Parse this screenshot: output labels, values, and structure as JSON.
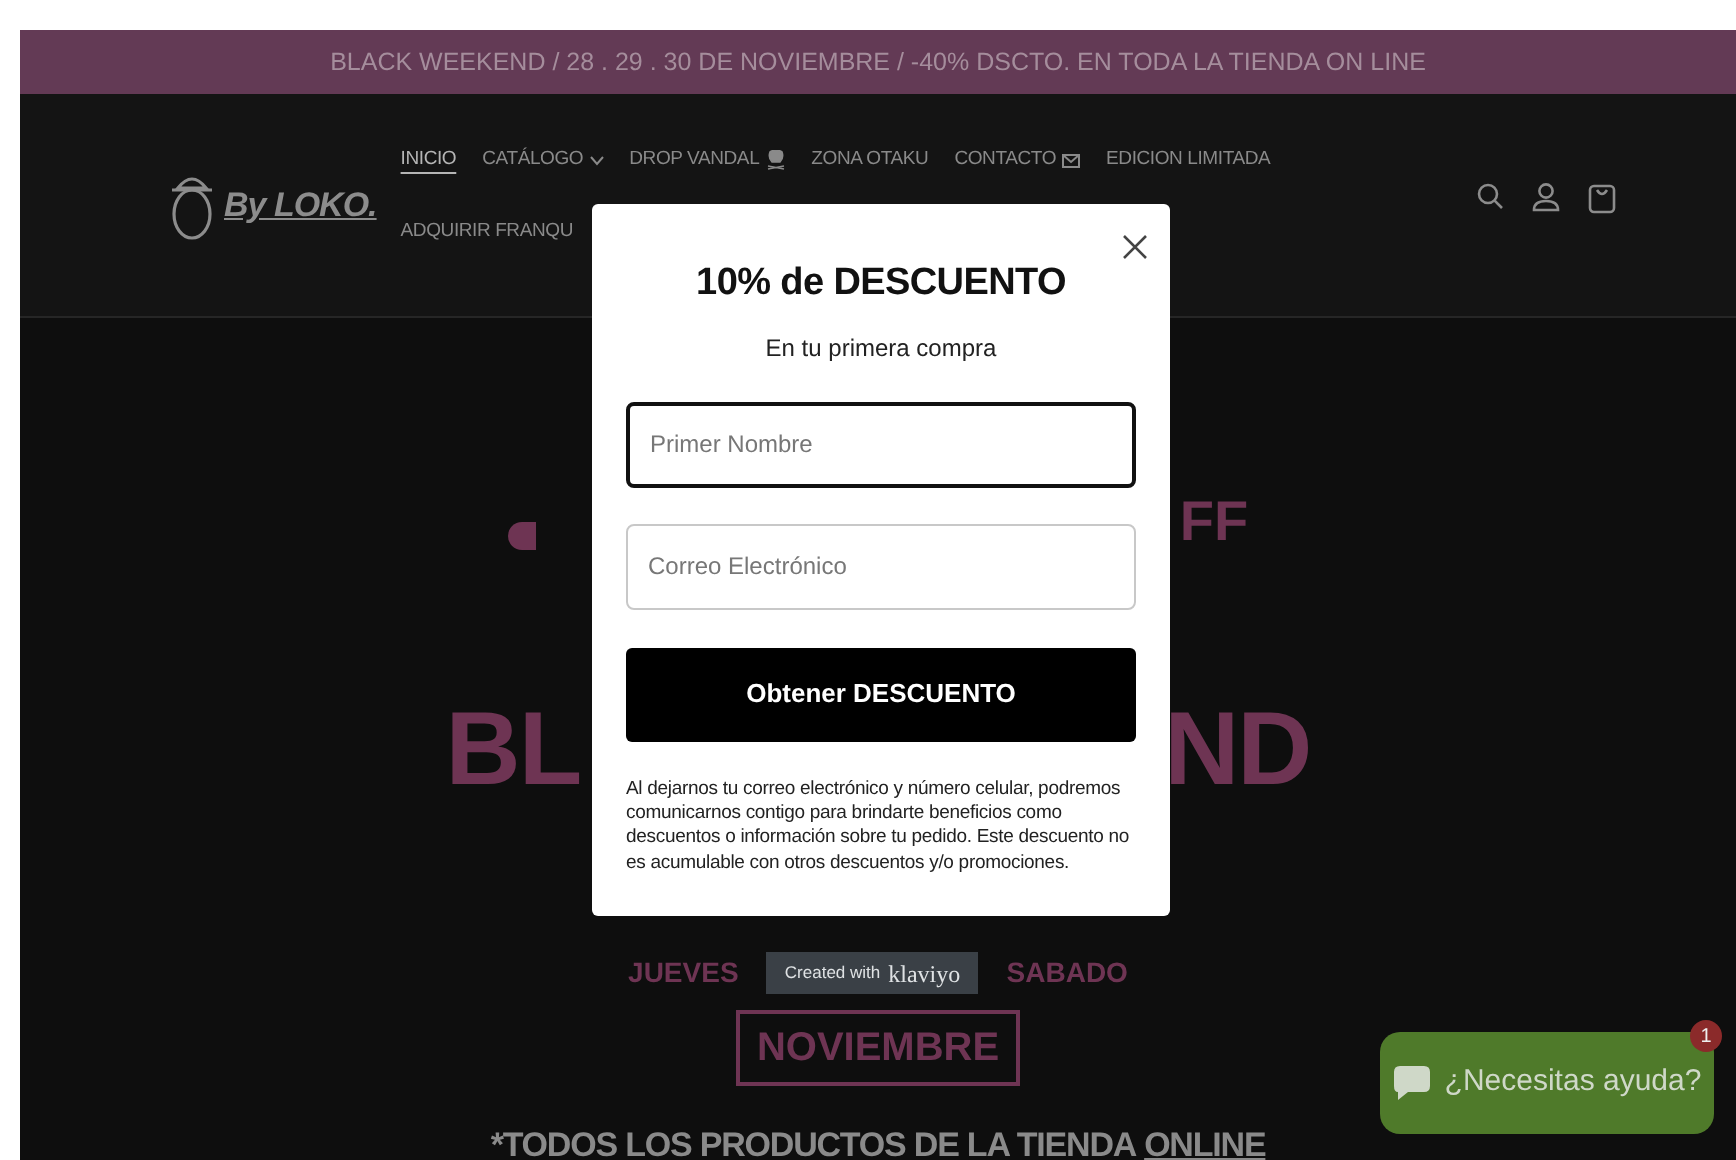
{
  "announcement": "BLACK WEEKEND / 28 . 29 . 30 DE NOVIEMBRE / -40% DSCTO. EN TODA LA TIENDA ON LINE",
  "logo": {
    "text": "By LOKO."
  },
  "nav_rows": [
    {
      "items": [
        {
          "label": "INICIO",
          "selected": true,
          "kind": "plain"
        },
        {
          "label": "CATÁLOGO",
          "selected": false,
          "kind": "dropdown"
        },
        {
          "label": "DROP VANDAL",
          "selected": false,
          "kind": "skull"
        },
        {
          "label": "ZONA OTAKU",
          "selected": false,
          "kind": "plain"
        },
        {
          "label": "CONTACTO",
          "selected": false,
          "kind": "mail"
        },
        {
          "label": "EDICION LIMITADA",
          "selected": false,
          "kind": "plain"
        }
      ]
    },
    {
      "items": [
        {
          "label": "ADQUIRIR FRANQU",
          "selected": false,
          "kind": "plain"
        }
      ]
    }
  ],
  "hero": {
    "fragment_top": "FF",
    "fragment_left": "BL",
    "fragment_right": "ND",
    "day_left": "JUEVES",
    "day_right": "SABADO",
    "month": "NOVIEMBRE",
    "footnote": "*TODOS LOS PRODUCTOS DE LA TIENDA",
    "footnote_link": "ONLINE"
  },
  "popup": {
    "title": "10% de DESCUENTO",
    "subtitle": "En tu primera compra",
    "fields": [
      {
        "placeholder": "Primer Nombre",
        "focused": true
      },
      {
        "placeholder": "Correo Electrónico",
        "focused": false
      }
    ],
    "button": "Obtener DESCUENTO",
    "disclaimer": "Al dejarnos tu correo electrónico y número celular, podremos comunicarnos contigo para brindarte beneficios como descuentos o información sobre tu pedido. Este descuento no es acumulable con otros descuentos y/o promociones."
  },
  "klaviyo": {
    "prefix": "Created with",
    "brand": "klaviyo"
  },
  "chat": {
    "label": "¿Necesitas ayuda?",
    "badge": "1"
  }
}
